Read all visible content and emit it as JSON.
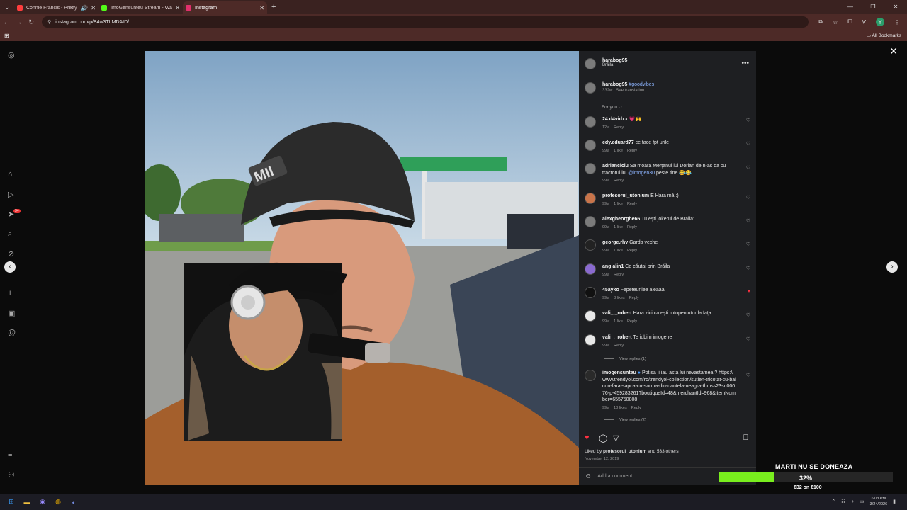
{
  "browser": {
    "tabs": [
      {
        "title": "Connie Francis - Pretty Littl",
        "color": "#ff3d3d",
        "has_audio": true,
        "active": false
      },
      {
        "title": "ImoGensunteu Stream - Watch",
        "color": "#53fc18",
        "active": false
      },
      {
        "title": "Instagram",
        "color": "#e1306c",
        "active": true
      }
    ],
    "url": "instagram.com/p/B4w3TLMDAID/",
    "bookmarks_label": "All Bookmarks",
    "profile_initial": "Y"
  },
  "left_nav": {
    "notifications_badge": "9+"
  },
  "post": {
    "username": "harabog95",
    "location": "Brăila",
    "caption": {
      "user": "harabog95",
      "hashtag": "#goodvibes",
      "age": "332w",
      "translate": "See translation"
    },
    "sort_label": "For you ⌵",
    "comments": [
      {
        "user": "24.d4vidxx",
        "text": "💗🙌",
        "age": "12w",
        "likes": "",
        "reply": "Reply",
        "liked": false
      },
      {
        "user": "edy.eduard77",
        "text": "ce face fpt urile",
        "age": "99w",
        "likes": "1 like",
        "reply": "Reply",
        "liked": false
      },
      {
        "user": "adrianciciu",
        "text": "Sa moara Merțanul lui Dorian de n-aș da cu tractorul lui",
        "mention": "@imogen30",
        "text2": "peste tine 😂😂",
        "age": "99w",
        "likes": "",
        "reply": "Reply",
        "liked": false
      },
      {
        "user": "profesorul_utonium",
        "text": "E Hara mă :)",
        "age": "99w",
        "likes": "1 like",
        "reply": "Reply",
        "liked": false
      },
      {
        "user": "alexgheorghe66",
        "text": "Tu ești jokerul de Braila:.",
        "age": "99w",
        "likes": "1 like",
        "reply": "Reply",
        "liked": false
      },
      {
        "user": "george.rhv",
        "text": "Garda veche",
        "age": "99w",
        "likes": "1 like",
        "reply": "Reply",
        "liked": false
      },
      {
        "user": "ang.alin1",
        "text": "Ce căutai prin Brăila",
        "age": "99w",
        "likes": "",
        "reply": "Reply",
        "liked": false
      },
      {
        "user": "45ayko",
        "text": "Fepeteurilee aleaaa",
        "age": "99w",
        "likes": "3 likes",
        "reply": "Reply",
        "liked": true
      },
      {
        "user": "vali_._robert",
        "text": "Hara zici ca ești rotopercutor la fața",
        "age": "99w",
        "likes": "1 like",
        "reply": "Reply",
        "liked": false
      },
      {
        "user": "vali_._robert",
        "text": "Te iubim imogene",
        "age": "99w",
        "likes": "",
        "reply": "Reply",
        "liked": false,
        "view_replies": "View replies (1)"
      },
      {
        "user": "imogensunteu",
        "text": "Pot sa ii iau asta lui nevastamea ? https://www.trendyol.com/ro/trendyol-collection/sutien-tricotat-cu-balcon-fara-sapca-cu-sarma-din-dantela-neagra-thmss23su00076-p-459283261?boutiqueId=48&merchantId=968&itemNumber=655750808",
        "age": "99w",
        "likes": "13 likes",
        "reply": "Reply",
        "liked": false,
        "view_replies": "View replies (2)",
        "verified": true
      }
    ],
    "liked_by_prefix": "Liked by",
    "liked_by_user": "profesorul_utonium",
    "liked_by_suffix": "and 533 others",
    "date": "November 12, 2019",
    "add_comment_placeholder": "Add a comment..."
  },
  "donation": {
    "title": "MARTI NU SE DONEAZA",
    "percent_label": "32%",
    "progress": 0.32,
    "amount": "€32 on €100",
    "bar_color": "#79ee1e"
  },
  "taskbar": {
    "time": "6:03 PM",
    "date": "3/24/2026"
  }
}
